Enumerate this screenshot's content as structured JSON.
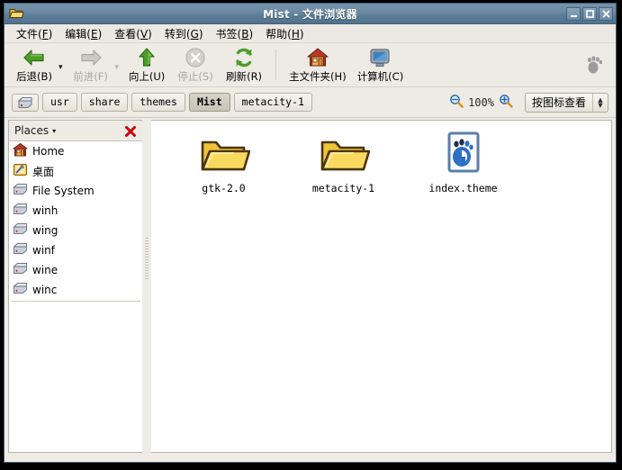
{
  "window": {
    "title": "Mist - 文件浏览器",
    "icon": "folder-icon",
    "controls": {
      "minimize": "_",
      "maximize": "□",
      "close": "✕"
    }
  },
  "menubar": {
    "items": [
      {
        "label": "文件(F)",
        "text": "文件(",
        "mnemonic": "F",
        "tail": ")"
      },
      {
        "label": "编辑(E)",
        "text": "编辑(",
        "mnemonic": "E",
        "tail": ")"
      },
      {
        "label": "查看(V)",
        "text": "查看(",
        "mnemonic": "V",
        "tail": ")"
      },
      {
        "label": "转到(G)",
        "text": "转到(",
        "mnemonic": "G",
        "tail": ")"
      },
      {
        "label": "书签(B)",
        "text": "书签(",
        "mnemonic": "B",
        "tail": ")"
      },
      {
        "label": "帮助(H)",
        "text": "帮助(",
        "mnemonic": "H",
        "tail": ")"
      }
    ]
  },
  "toolbar": {
    "back": {
      "label": "后退(B)",
      "icon": "back-arrow-icon",
      "enabled": true
    },
    "back_dropdown": "▾",
    "forward": {
      "label": "前进(F)",
      "icon": "forward-arrow-icon",
      "enabled": false
    },
    "forward_dropdown": "▾",
    "up": {
      "label": "向上(U)",
      "icon": "up-arrow-icon",
      "enabled": true
    },
    "stop": {
      "label": "停止(S)",
      "icon": "stop-icon",
      "enabled": false
    },
    "reload": {
      "label": "刷新(R)",
      "icon": "reload-icon",
      "enabled": true
    },
    "home": {
      "label": "主文件夹(H)",
      "icon": "home-icon",
      "enabled": true
    },
    "computer": {
      "label": "计算机(C)",
      "icon": "computer-icon",
      "enabled": true
    },
    "brand": {
      "icon": "gnome-foot-icon"
    }
  },
  "pathbar": {
    "leading_icon": "drive-icon",
    "crumbs": [
      {
        "label": "usr",
        "active": false
      },
      {
        "label": "share",
        "active": false
      },
      {
        "label": "themes",
        "active": false
      },
      {
        "label": "Mist",
        "active": true
      },
      {
        "label": "metacity-1",
        "active": false
      }
    ],
    "zoom_out_icon": "zoom-out-icon",
    "zoom_level": "100%",
    "zoom_in_icon": "zoom-in-icon",
    "view_mode": "按图标查看"
  },
  "sidebar": {
    "header": {
      "title": "Places",
      "caret": "▾",
      "close_icon": "close-icon"
    },
    "items": [
      {
        "label": "Home",
        "icon": "home-icon"
      },
      {
        "label": "桌面",
        "icon": "desktop-icon"
      },
      {
        "label": "File System",
        "icon": "drive-icon"
      },
      {
        "label": "winh",
        "icon": "drive-icon"
      },
      {
        "label": "wing",
        "icon": "drive-icon"
      },
      {
        "label": "winf",
        "icon": "drive-icon"
      },
      {
        "label": "wine",
        "icon": "drive-icon"
      },
      {
        "label": "winc",
        "icon": "drive-icon"
      }
    ]
  },
  "content": {
    "files": [
      {
        "label": "gtk-2.0",
        "type": "folder"
      },
      {
        "label": "metacity-1",
        "type": "folder"
      },
      {
        "label": "index.theme",
        "type": "gnome-theme-file"
      }
    ]
  },
  "colors": {
    "titlebar": "#6a8aa4",
    "toolbar_bg": "#eeebe5",
    "content_bg": "#ffffff",
    "folder_yellow": "#f5c839",
    "accent_green": "#3f9e20",
    "close_red": "#cc0000"
  }
}
